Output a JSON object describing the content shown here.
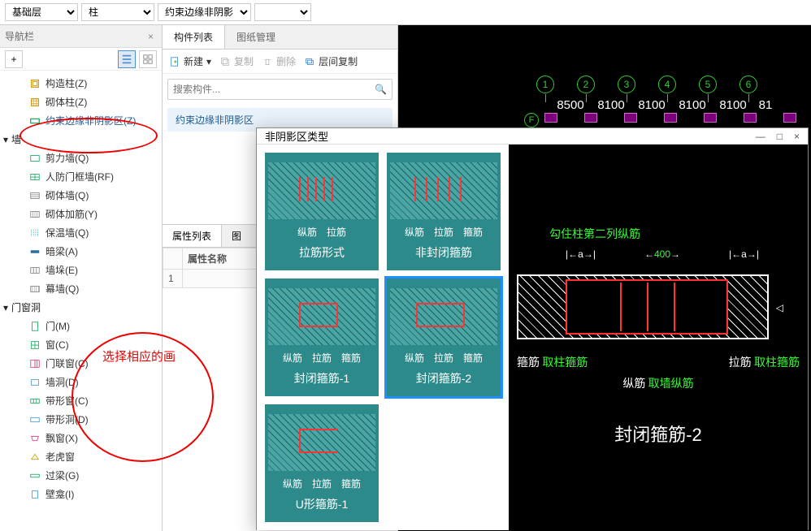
{
  "top_selects": {
    "floor": "基础层",
    "col": "柱",
    "type": "约束边缘非阴影",
    "empty": ""
  },
  "nav": {
    "panel_title": "导航栏",
    "col_items": [
      {
        "label": "构造柱(Z)",
        "icon": "col-generic"
      },
      {
        "label": "砌体柱(Z)",
        "icon": "col-brick"
      },
      {
        "label": "约束边缘非阴影区(Z)",
        "icon": "col-edge"
      }
    ],
    "wall_group": "墙",
    "wall_items": [
      {
        "label": "剪力墙(Q)",
        "icon": "wall"
      },
      {
        "label": "人防门框墙(RF)",
        "icon": "wall"
      },
      {
        "label": "砌体墙(Q)",
        "icon": "wall"
      },
      {
        "label": "砌体加筋(Y)",
        "icon": "wall"
      },
      {
        "label": "保温墙(Q)",
        "icon": "wall"
      },
      {
        "label": "暗梁(A)",
        "icon": "beam"
      },
      {
        "label": "墙垛(E)",
        "icon": "wall"
      },
      {
        "label": "幕墙(Q)",
        "icon": "wall"
      }
    ],
    "door_group": "门窗洞",
    "door_items": [
      {
        "label": "门(M)",
        "icon": "door"
      },
      {
        "label": "窗(C)",
        "icon": "window"
      },
      {
        "label": "门联窗(C)",
        "icon": "doorwin"
      },
      {
        "label": "墙洞(D)",
        "icon": "hole"
      },
      {
        "label": "带形窗(C)",
        "icon": "window"
      },
      {
        "label": "带形洞(D)",
        "icon": "hole"
      },
      {
        "label": "飘窗(X)",
        "icon": "baywin"
      },
      {
        "label": "老虎窗",
        "icon": "dormer"
      },
      {
        "label": "过梁(G)",
        "icon": "lintel"
      },
      {
        "label": "壁龛(I)",
        "icon": "niche"
      }
    ],
    "annotation_text": "选择相应的画"
  },
  "mid": {
    "tab_list": "构件列表",
    "tab_draw": "图纸管理",
    "btn_new": "新建",
    "btn_copy": "复制",
    "btn_delete": "删除",
    "btn_layer_copy": "层间复制",
    "search_placeholder": "搜索构件...",
    "comp_item": "约束边缘非阴影区",
    "prop_tab_1": "属性列表",
    "prop_tab_2": "图",
    "prop_header": "属性名称",
    "row_num": "1"
  },
  "canvas": {
    "axes": [
      "1",
      "2",
      "3",
      "4",
      "5",
      "6"
    ],
    "dims": [
      "8500",
      "8100",
      "8100",
      "8100",
      "8100",
      "81"
    ],
    "axis_f": "F"
  },
  "dialog": {
    "title": "非阴影区类型",
    "cards": [
      {
        "labels": "纵筋　拉筋",
        "name": "拉筋形式"
      },
      {
        "labels": "纵筋　拉筋　箍筋",
        "name": "非封闭箍筋"
      },
      {
        "labels": "纵筋　拉筋　箍筋",
        "name": "封闭箍筋-1"
      },
      {
        "labels": "纵筋　拉筋　箍筋",
        "name": "封闭箍筋-2"
      },
      {
        "labels": "纵筋　拉筋　箍筋",
        "name": "U形箍筋-1"
      }
    ],
    "preview": {
      "note": "勾住柱第二列纵筋",
      "dim_a": "a",
      "dim_400": "400",
      "hoop_lbl": "箍筋",
      "hoop_val": "取柱箍筋",
      "tie_lbl": "拉筋",
      "tie_val": "取柱箍筋",
      "long_lbl": "纵筋",
      "long_val": "取墙纵筋",
      "name": "封闭箍筋-2"
    }
  }
}
